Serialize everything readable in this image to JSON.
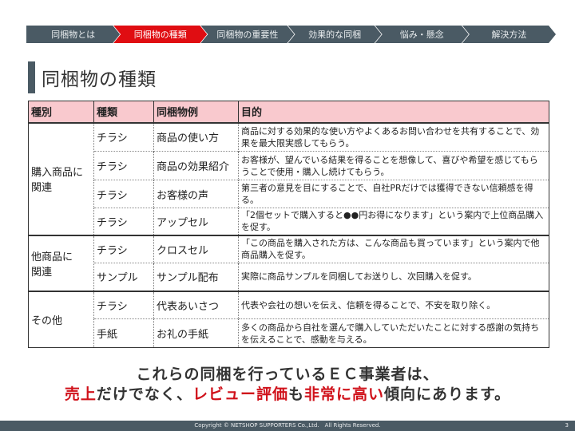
{
  "nav": {
    "steps": [
      "同梱物とは",
      "同梱物の種類",
      "同梱物の重要性",
      "効果的な同梱",
      "悩み・懸念",
      "解決方法"
    ],
    "active_index": 1
  },
  "title": "同梱物の種類",
  "table": {
    "headers": [
      "種別",
      "種類",
      "同梱物例",
      "目的"
    ],
    "groups": [
      {
        "category": "購入商品に関連",
        "rows": [
          {
            "type": "チラシ",
            "example": "商品の使い方",
            "purpose": "商品に対する効果的な使い方やよくあるお問い合わせを共有することで、効果を最大限実感してもらう。"
          },
          {
            "type": "チラシ",
            "example": "商品の効果紹介",
            "purpose": "お客様が、望んでいる結果を得ることを想像して、喜びや希望を感じてもらうことで使用・購入し続けてもらう。"
          },
          {
            "type": "チラシ",
            "example": "お客様の声",
            "purpose": "第三者の意見を目にすることで、自社PRだけでは獲得できない信頼感を得る。"
          },
          {
            "type": "チラシ",
            "example": "アップセル",
            "purpose": "「2個セットで購入すると●●円お得になります」という案内で上位商品購入を促す。"
          }
        ]
      },
      {
        "category": "他商品に関連",
        "rows": [
          {
            "type": "チラシ",
            "example": "クロスセル",
            "purpose": "「この商品を購入された方は、こんな商品も買っています」という案内で他商品購入を促す。"
          },
          {
            "type": "サンプル",
            "example": "サンプル配布",
            "purpose": "実際に商品サンプルを同梱してお送りし、次回購入を促す。"
          }
        ]
      },
      {
        "category": "その他",
        "rows": [
          {
            "type": "チラシ",
            "example": "代表あいさつ",
            "purpose": "代表や会社の想いを伝え、信頼を得ることで、不安を取り除く。"
          },
          {
            "type": "手紙",
            "example": "お礼の手紙",
            "purpose": "多くの商品から自社を選んで購入していただいたことに対する感謝の気持ちを伝えることで、感動を与える。"
          }
        ]
      }
    ]
  },
  "message": {
    "line1": "これらの同梱を行っているＥＣ事業者は、",
    "line2_parts": [
      "売上",
      "だけでなく、",
      "レビュー評価",
      "も",
      "非常に高い",
      "傾向にあります。"
    ]
  },
  "footer": {
    "copyright": "Copyright © NETSHOP SUPPORTERS Co.,Ltd.　All Rights Reserved.",
    "page": "3"
  },
  "colors": {
    "nav": "#4a5a64",
    "active": "#e00d12",
    "header_bg": "#f9c9ce",
    "emphasis": "#d0111a"
  }
}
